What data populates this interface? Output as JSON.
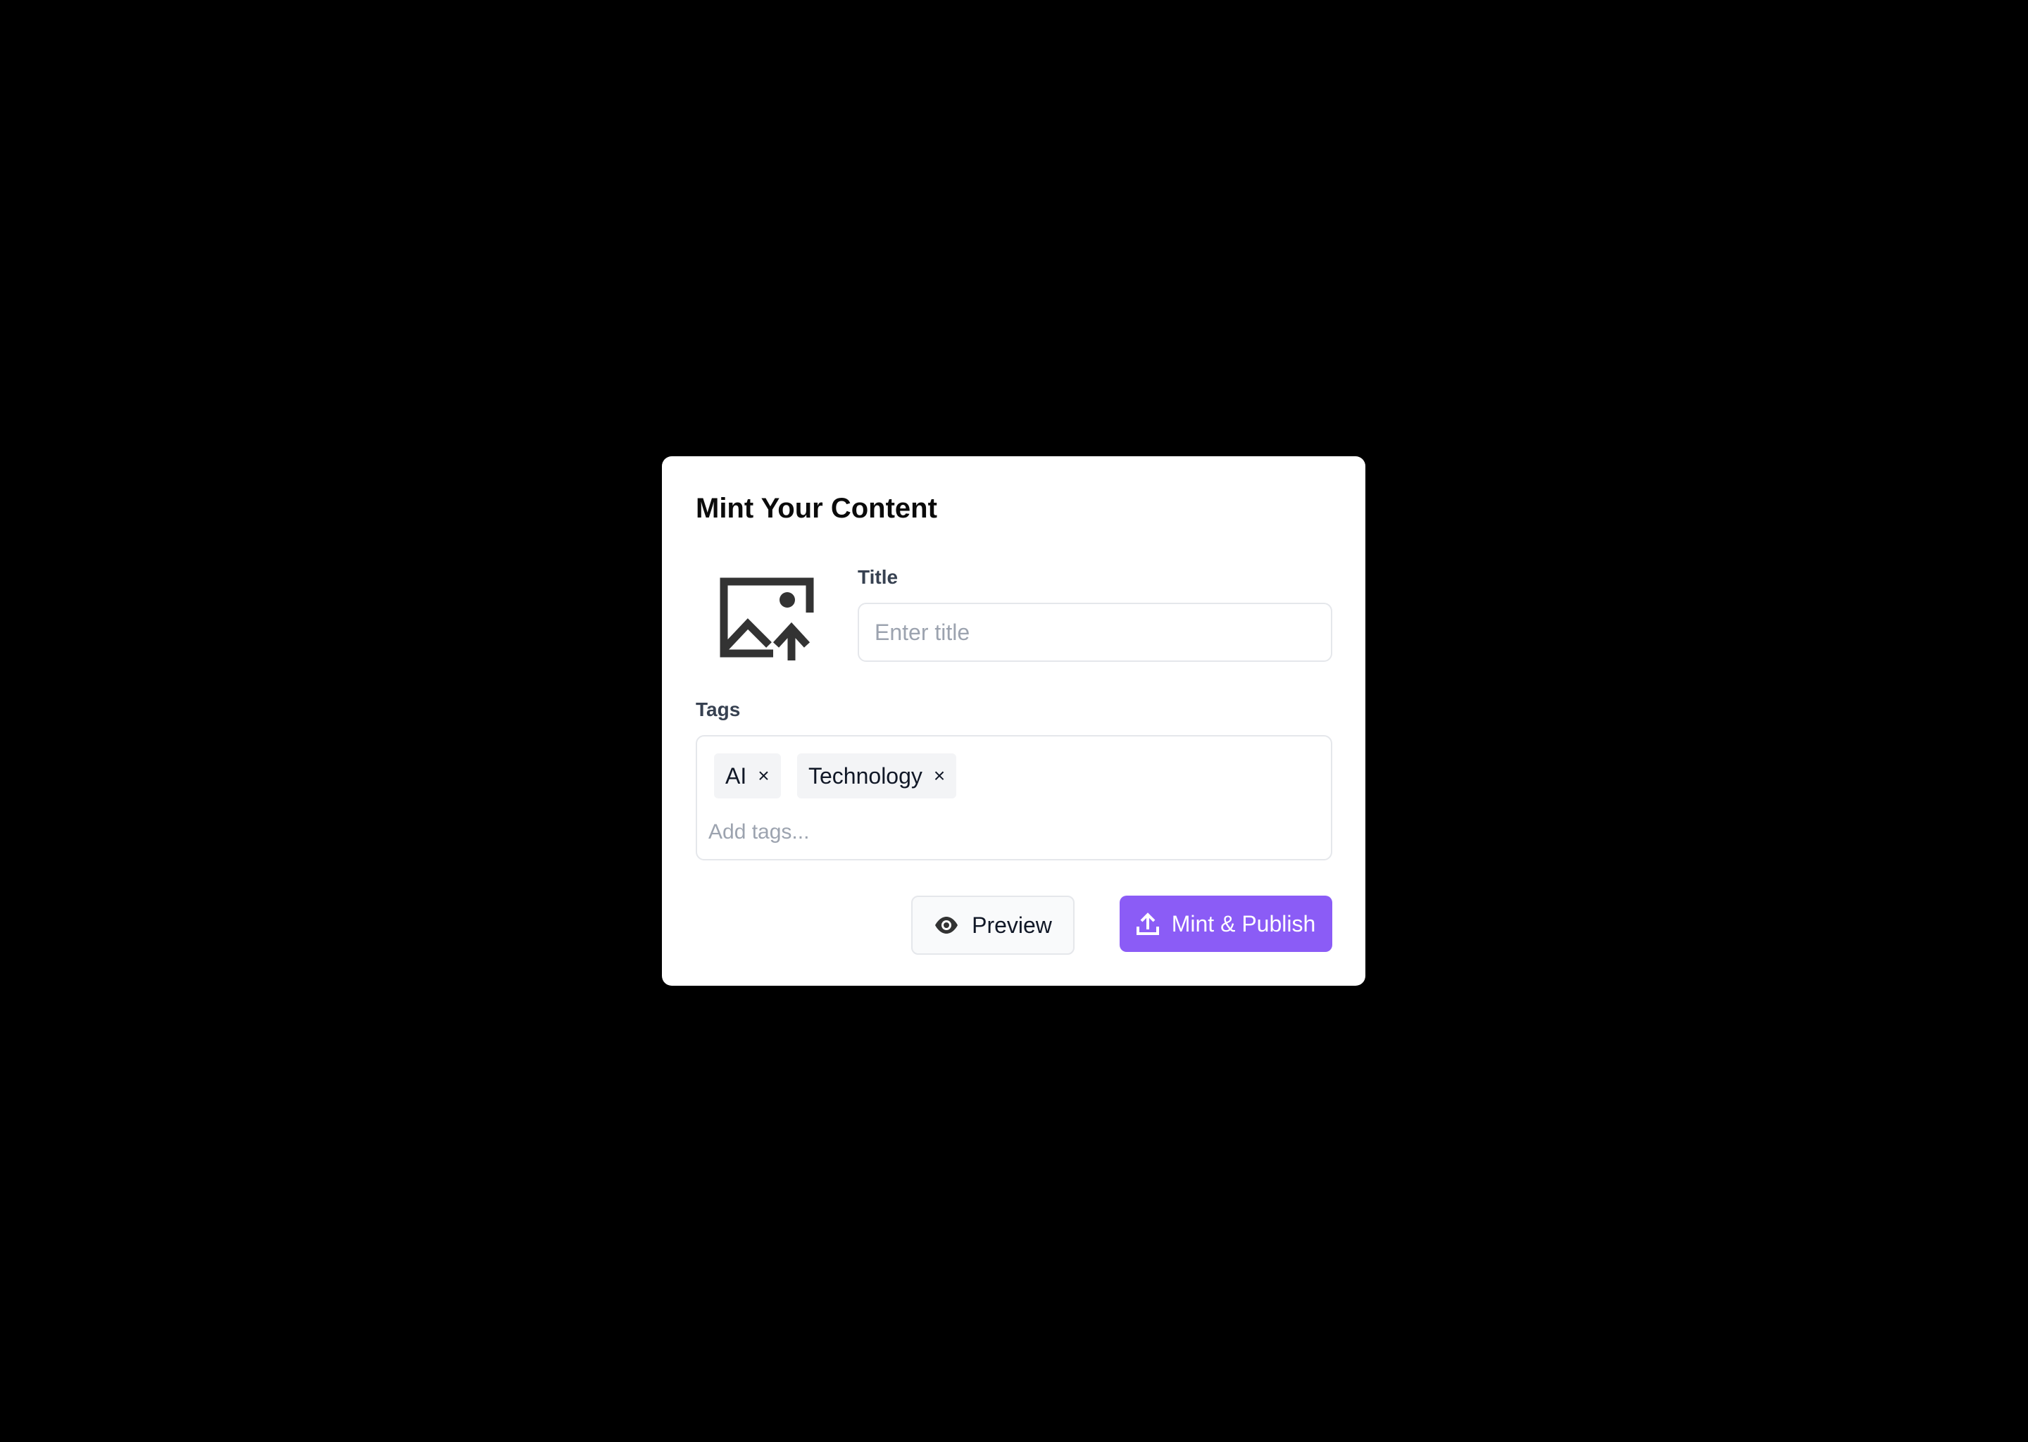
{
  "modal": {
    "title": "Mint Your Content",
    "upload_icon": "image-upload-icon"
  },
  "fields": {
    "title_label": "Title",
    "title_value": "",
    "title_placeholder": "Enter title",
    "tags_label": "Tags",
    "tags": [
      {
        "label": "AI",
        "remove": "×"
      },
      {
        "label": "Technology",
        "remove": "×"
      }
    ],
    "tags_value": "",
    "tags_placeholder": "Add tags..."
  },
  "actions": {
    "preview_label": "Preview",
    "preview_icon": "eye-icon",
    "mint_label": "Mint & Publish",
    "mint_icon": "upload-icon"
  },
  "colors": {
    "accent": "#8b5cf6",
    "background": "#000000",
    "surface": "#ffffff",
    "chip": "#f3f4f6",
    "icon": "#333333"
  }
}
